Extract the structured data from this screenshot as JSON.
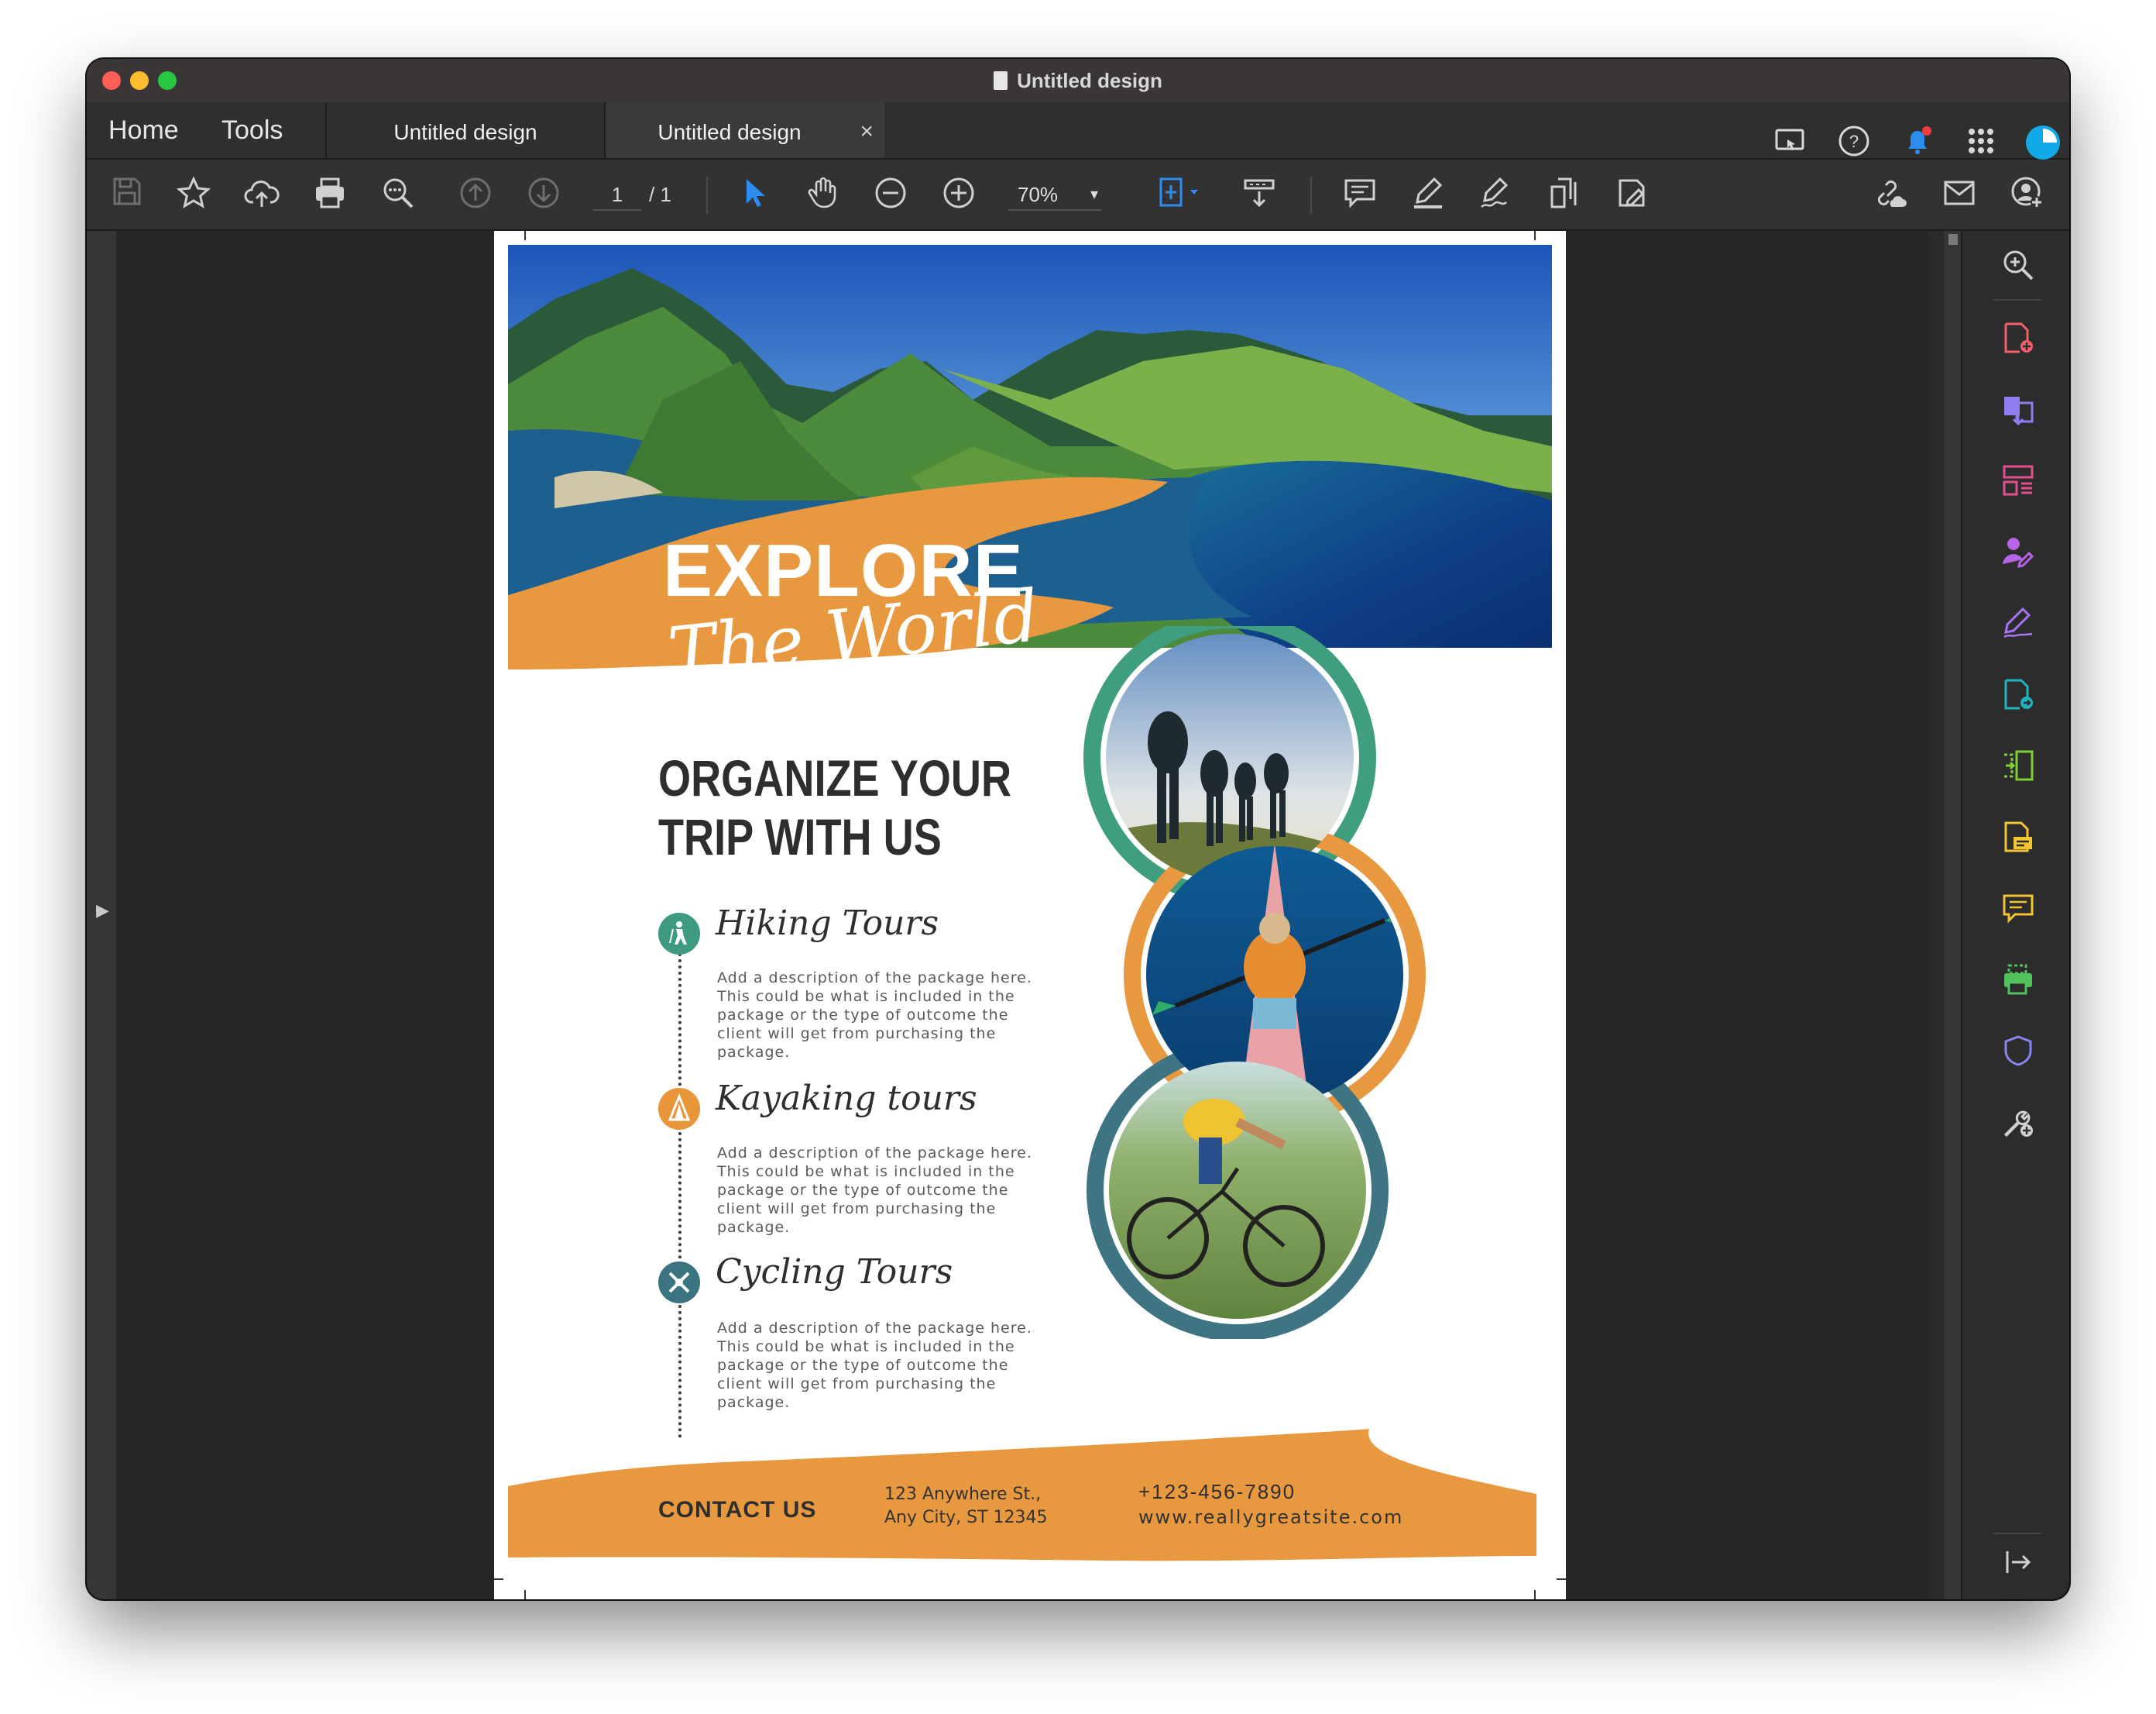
{
  "window": {
    "title": "Untitled design",
    "traffic_lights": [
      "#ff5f57",
      "#febc2e",
      "#28c840"
    ]
  },
  "nav": {
    "home": "Home",
    "tools": "Tools",
    "tabs": [
      {
        "label": "Untitled design",
        "active": false
      },
      {
        "label": "Untitled design",
        "active": true
      }
    ],
    "close_icon": "×"
  },
  "toolbar": {
    "page_current": "1",
    "page_total": "/ 1",
    "zoom": "70%"
  },
  "flyer": {
    "explore": "EXPLORE",
    "world": "The World",
    "headline_line1": "ORGANIZE YOUR",
    "headline_line2": "TRIP WITH US",
    "tours": [
      {
        "title": "Hiking Tours",
        "description": "Add a description of the package here. This could be what is included in the package or the type of outcome the client will get from purchasing the package.",
        "color": "#3f9a82"
      },
      {
        "title": "Kayaking tours",
        "description": "Add a description of the package here. This could be what is included in the package or the type of outcome the client will get from purchasing the package.",
        "color": "#e8963a"
      },
      {
        "title": "Cycling Tours",
        "description": "Add a description of the package here. This could be what is included in the package or the type of outcome the client will get from purchasing the package.",
        "color": "#3b7480"
      }
    ],
    "contact_label": "CONTACT US",
    "address_line1": "123 Anywhere St.,",
    "address_line2": "Any City, ST 12345",
    "phone": "+123-456-7890",
    "website": "www.reallygreatsite.com",
    "accent_orange": "#e8993f",
    "accent_green": "#3f9e80",
    "accent_teal": "#3f7583"
  }
}
